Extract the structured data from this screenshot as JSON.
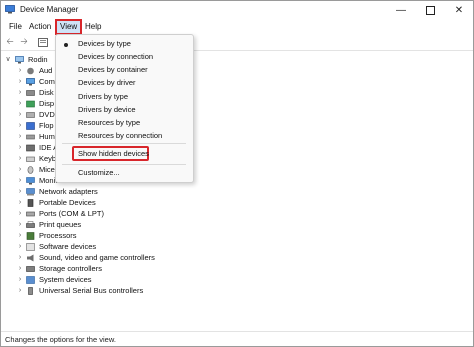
{
  "window": {
    "title": "Device Manager"
  },
  "menubar": {
    "items": [
      "File",
      "Action",
      "View",
      "Help"
    ]
  },
  "tree": {
    "root": "Rodin",
    "items": [
      "Aud",
      "Com",
      "Disk",
      "Disp",
      "DVD",
      "Flop",
      "Hum",
      "IDE A",
      "Keyb",
      "Mice",
      "Monitors",
      "Network adapters",
      "Portable Devices",
      "Ports (COM & LPT)",
      "Print queues",
      "Processors",
      "Software devices",
      "Sound, video and game controllers",
      "Storage controllers",
      "System devices",
      "Universal Serial Bus controllers"
    ]
  },
  "view_menu": {
    "items": [
      "Devices by type",
      "Devices by connection",
      "Devices by container",
      "Devices by driver",
      "Drivers by type",
      "Drivers by device",
      "Resources by type",
      "Resources by connection",
      "Show hidden devices",
      "Customize..."
    ],
    "checked": "Devices by type"
  },
  "statusbar": {
    "text": "Changes the options for the view."
  },
  "colors": {
    "highlight_border": "#d8262b",
    "active_menu_bg": "#cfe3f7"
  }
}
